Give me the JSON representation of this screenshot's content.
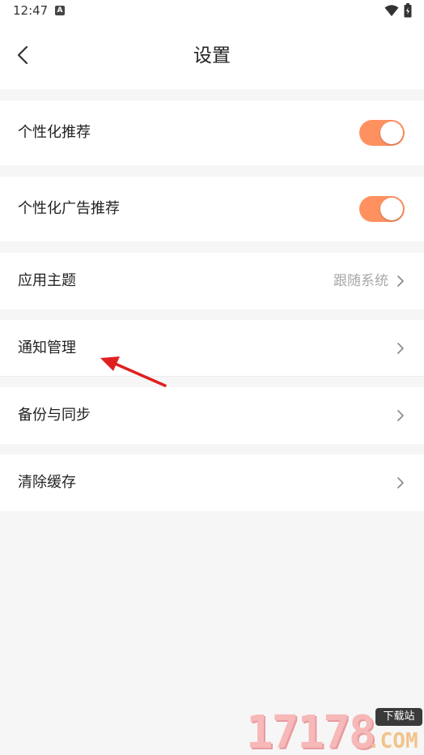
{
  "status_bar": {
    "time": "12:47",
    "a_badge": "A"
  },
  "header": {
    "title": "设置"
  },
  "settings": {
    "personalized_recommend": {
      "label": "个性化推荐",
      "enabled": true
    },
    "personalized_ads": {
      "label": "个性化广告推荐",
      "enabled": true
    },
    "app_theme": {
      "label": "应用主题",
      "value": "跟随系统"
    },
    "notification_manage": {
      "label": "通知管理"
    },
    "backup_sync": {
      "label": "备份与同步"
    },
    "clear_cache": {
      "label": "清除缓存"
    }
  },
  "colors": {
    "toggle_on": "#ff9160",
    "annotation_arrow": "#e02020",
    "background": "#f6f6f6"
  },
  "watermark": {
    "digits": "17178",
    "tag": "下载站",
    "suffix": ".COM"
  }
}
